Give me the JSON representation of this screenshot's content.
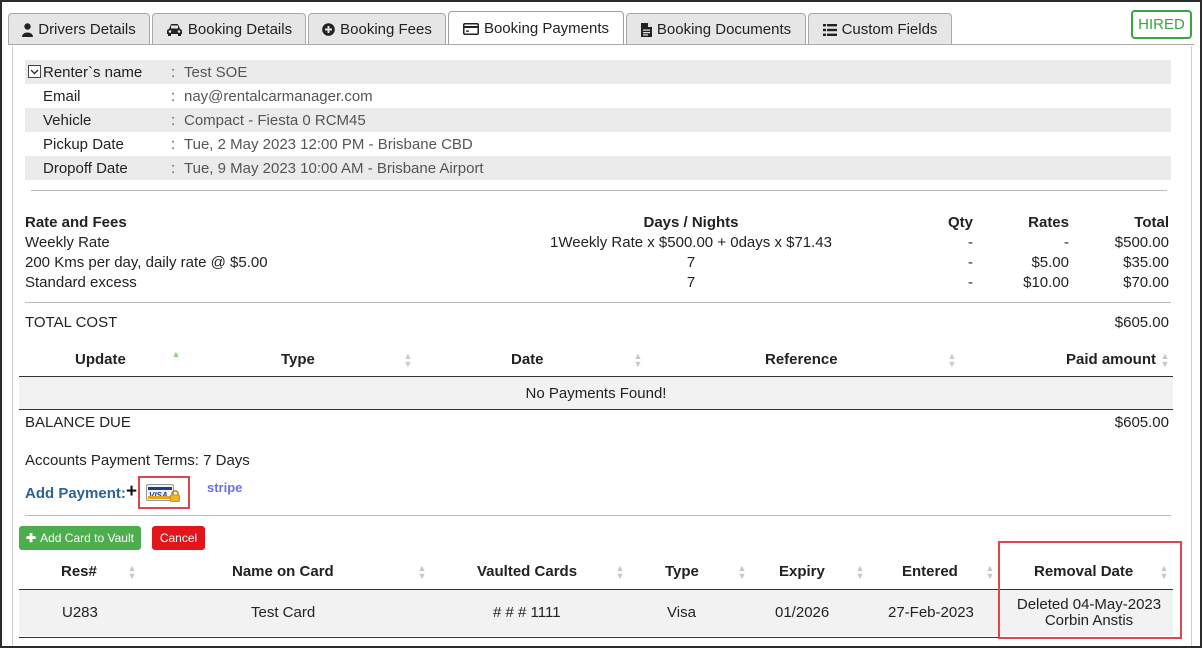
{
  "tabs": [
    {
      "label": "Drivers Details",
      "icon": "user-icon"
    },
    {
      "label": "Booking Details",
      "icon": "car-icon"
    },
    {
      "label": "Booking Fees",
      "icon": "plus-circle-icon"
    },
    {
      "label": "Booking Payments",
      "icon": "credit-card-icon",
      "active": true
    },
    {
      "label": "Booking Documents",
      "icon": "document-icon"
    },
    {
      "label": "Custom Fields",
      "icon": "list-icon"
    }
  ],
  "status_badge": "HIRED",
  "renter": {
    "rows": [
      {
        "label": "Renter`s name",
        "value": "Test SOE"
      },
      {
        "label": "Email",
        "value": "nay@rentalcarmanager.com"
      },
      {
        "label": "Vehicle",
        "value": "Compact - Fiesta 0 RCM45"
      },
      {
        "label": "Pickup Date",
        "value": "Tue, 2 May 2023 12:00 PM - Brisbane CBD"
      },
      {
        "label": "Dropoff Date",
        "value": "Tue, 9 May 2023 10:00 AM - Brisbane Airport"
      }
    ],
    "colon": ":"
  },
  "fees": {
    "headers": {
      "name": "Rate and Fees",
      "days": "Days / Nights",
      "qty": "Qty",
      "rates": "Rates",
      "total": "Total"
    },
    "rows": [
      {
        "name": "Weekly Rate",
        "days": "1Weekly Rate x $500.00 + 0days x $71.43",
        "qty": "-",
        "rates": "-",
        "total": "$500.00"
      },
      {
        "name": "200 Kms per day, daily rate @ $5.00",
        "days": "7",
        "qty": "-",
        "rates": "$5.00",
        "total": "$35.00"
      },
      {
        "name": "Standard excess",
        "days": "7",
        "qty": "-",
        "rates": "$10.00",
        "total": "$70.00"
      }
    ],
    "total_label": "TOTAL COST",
    "total_value": "$605.00"
  },
  "payments": {
    "headers": [
      "Update",
      "Type",
      "Date",
      "Reference",
      "Paid amount"
    ],
    "empty_message": "No Payments Found!",
    "balance_label": "BALANCE DUE",
    "balance_value": "$605.00",
    "terms": "Accounts Payment Terms: 7 Days",
    "add_payment_label": "Add Payment:",
    "add_icon": "+",
    "visa_label": "VISA",
    "stripe_label": "stripe"
  },
  "vault": {
    "add_button": "Add Card to Vault",
    "cancel_button": "Cancel",
    "headers": [
      "Res#",
      "Name on Card",
      "Vaulted Cards",
      "Type",
      "Expiry",
      "Entered",
      "Removal Date"
    ],
    "rows": [
      {
        "res": "U283",
        "name": "Test Card",
        "card": "# # # 1111",
        "type": "Visa",
        "expiry": "01/2026",
        "entered": "27-Feb-2023",
        "removal_line1": "Deleted 04-May-2023",
        "removal_line2": "Corbin Anstis"
      }
    ]
  },
  "colors": {
    "accent_green": "#37a63f",
    "button_green": "#4cae4c",
    "button_red": "#e4141b",
    "highlight_red": "#e0454a",
    "link_blue": "#2a6496",
    "stripe_purple": "#6772e5"
  }
}
